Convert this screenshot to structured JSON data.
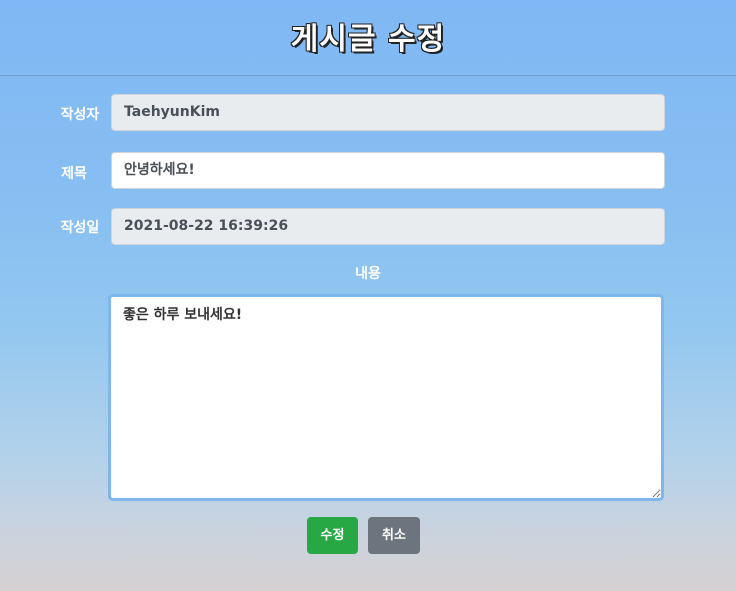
{
  "page": {
    "title": "게시글 수정"
  },
  "form": {
    "author_label": "작성자",
    "author_value": "TaehyunKim",
    "title_label": "제목",
    "title_value": "안녕하세요!",
    "date_label": "작성일",
    "date_value": "2021-08-22 16:39:26",
    "content_label": "내용",
    "content_value": "좋은 하루 보내세요!"
  },
  "buttons": {
    "save_label": "수정",
    "cancel_label": "취소"
  },
  "colors": {
    "save": "#28a745",
    "cancel": "#6c757d",
    "readonly_bg": "#e9ecef",
    "focus_border": "#7fb6ee"
  }
}
